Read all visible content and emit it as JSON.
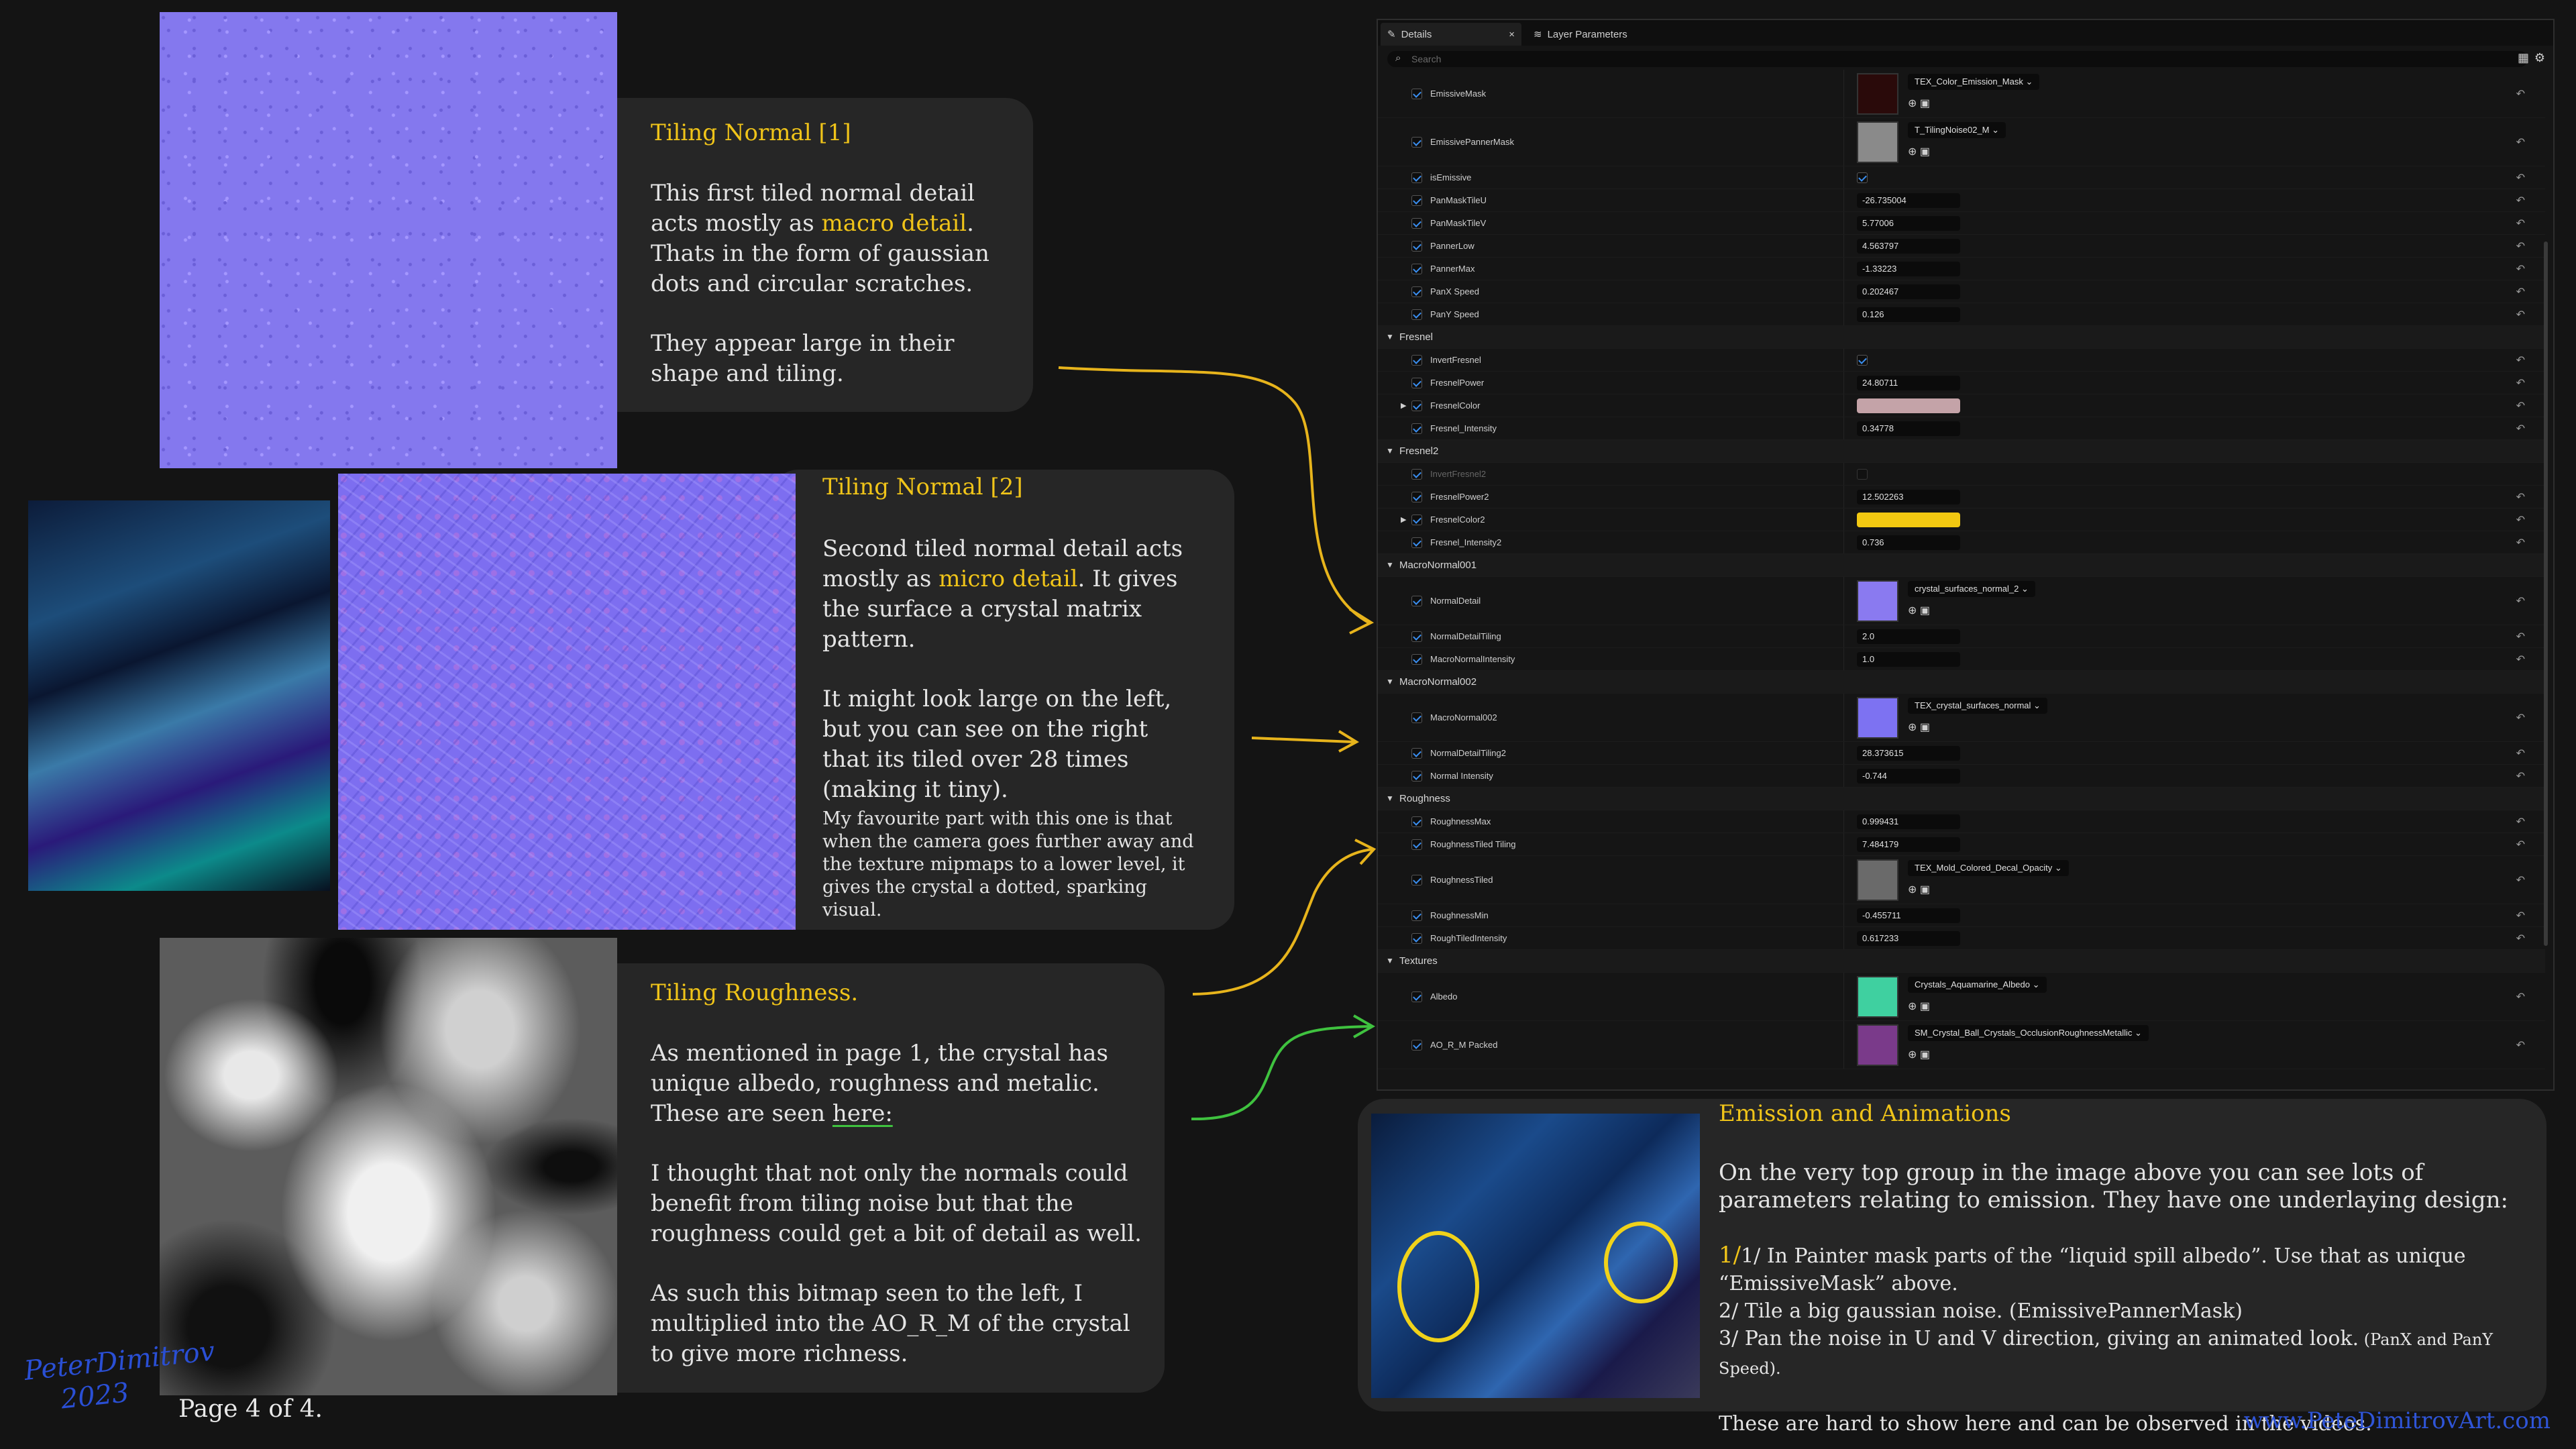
{
  "left_cards": {
    "normal1": {
      "title": "Tiling Normal [1]",
      "p1_a": "This first tiled normal detail acts mostly as ",
      "p1_hl": "macro detail",
      "p1_b": ". Thats in the form of gaussian dots and circular scratches.",
      "p2": "They appear large in their shape and tiling."
    },
    "normal2": {
      "title": "Tiling Normal [2]",
      "p1_a": "Second tiled normal detail acts mostly as ",
      "p1_hl": "micro detail",
      "p1_b": ". It gives the surface a crystal matrix pattern.",
      "p2": "It might look large on the left, but you can see on the right that its tiled over 28 times (making it tiny).",
      "p3": "My favourite part with this one is that when the camera goes further away and the texture mipmaps to a lower level, it gives the crystal a dotted, sparking visual."
    },
    "roughness": {
      "title": "Tiling Roughness.",
      "p1_a": "As mentioned in page 1, the crystal has unique albedo, roughness and metalic. These are seen ",
      "p1_link": "here:",
      "p2": "I thought that not only the normals could benefit from tiling noise but that the roughness could get a bit of detail as well.",
      "p3": "As such this bitmap seen to the left, I multiplied into the AO_R_M of the crystal to give more richness."
    }
  },
  "emission_card": {
    "title": "Emission and Animations",
    "intro": "On the very top group in the image above you can see lots of parameters relating to emission. They have one underlaying design:",
    "step1": "1/ In Painter mask parts of the “liquid spill albedo”. Use that as unique “EmissiveMask” above.",
    "step2": "2/ Tile a big gaussian noise. (EmissivePannerMask)",
    "step3_a": "3/ Pan the noise in U and V direction, giving an animated look.",
    "step3_b": " (PanX and PanY Speed).",
    "outro": "These are hard to show here and can be observed in the videos."
  },
  "footer": {
    "page": "Page 4 of 4.",
    "website": "www.PeteDimitrovArt.com",
    "signature_line1": "PeterDimitrov",
    "signature_line2": "2023"
  },
  "panel": {
    "tabs": [
      {
        "label": "Details",
        "close": "×"
      },
      {
        "label": "Layer Parameters"
      }
    ],
    "search_placeholder": "Search",
    "reset_glyph": "↶",
    "asset_icons": "⊕ ▣",
    "colors": {
      "fresnel_color": "#c4a3a8",
      "fresnel_color2": "#f2c811"
    },
    "rows": [
      {
        "kind": "tex",
        "label": "EmissiveMask",
        "asset": "TEX_Color_Emission_Mask",
        "thumb": "#2a0a0a"
      },
      {
        "kind": "tex",
        "label": "EmissivePannerMask",
        "asset": "T_TilingNoise02_M",
        "thumb": "#8a8a8a"
      },
      {
        "kind": "bool",
        "label": "isEmissive",
        "on": true
      },
      {
        "kind": "num",
        "label": "PanMaskTileU",
        "value": "-26.735004"
      },
      {
        "kind": "num",
        "label": "PanMaskTileV",
        "value": "5.77006"
      },
      {
        "kind": "num",
        "label": "PannerLow",
        "value": "4.563797"
      },
      {
        "kind": "num",
        "label": "PannerMax",
        "value": "-1.33223"
      },
      {
        "kind": "num",
        "label": "PanX Speed",
        "value": "0.202467"
      },
      {
        "kind": "num",
        "label": "PanY Speed",
        "value": "0.126"
      },
      {
        "kind": "group",
        "label": "Fresnel"
      },
      {
        "kind": "bool",
        "label": "InvertFresnel",
        "on": true
      },
      {
        "kind": "num",
        "label": "FresnelPower",
        "value": "24.80711"
      },
      {
        "kind": "color",
        "label": "FresnelColor",
        "color": "fresnel_color"
      },
      {
        "kind": "num",
        "label": "Fresnel_Intensity",
        "value": "0.34778"
      },
      {
        "kind": "group",
        "label": "Fresnel2"
      },
      {
        "kind": "bool",
        "label": "InvertFresnel2",
        "on": false,
        "disabled": true
      },
      {
        "kind": "num",
        "label": "FresnelPower2",
        "value": "12.502263"
      },
      {
        "kind": "color",
        "label": "FresnelColor2",
        "color": "fresnel_color2"
      },
      {
        "kind": "num",
        "label": "Fresnel_Intensity2",
        "value": "0.736"
      },
      {
        "kind": "group",
        "label": "MacroNormal001"
      },
      {
        "kind": "tex",
        "label": "NormalDetail",
        "asset": "crystal_surfaces_normal_2",
        "thumb": "#8a7af0"
      },
      {
        "kind": "num",
        "label": "NormalDetailTiling",
        "value": "2.0"
      },
      {
        "kind": "num",
        "label": "MacroNormalIntensity",
        "value": "1.0"
      },
      {
        "kind": "group",
        "label": "MacroNormal002"
      },
      {
        "kind": "tex",
        "label": "MacroNormal002",
        "asset": "TEX_crystal_surfaces_normal",
        "thumb": "#7d72f2"
      },
      {
        "kind": "num",
        "label": "NormalDetailTiling2",
        "value": "28.373615"
      },
      {
        "kind": "num",
        "label": "Normal Intensity",
        "value": "-0.744"
      },
      {
        "kind": "group",
        "label": "Roughness"
      },
      {
        "kind": "num",
        "label": "RoughnessMax",
        "value": "0.999431"
      },
      {
        "kind": "num",
        "label": "RoughnessTiled Tiling",
        "value": "7.484179"
      },
      {
        "kind": "tex",
        "label": "RoughnessTiled",
        "asset": "TEX_Mold_Colored_Decal_Opacity",
        "thumb": "#6a6a6a"
      },
      {
        "kind": "num",
        "label": "RoughnessMin",
        "value": "-0.455711"
      },
      {
        "kind": "num",
        "label": "RoughTiledIntensity",
        "value": "0.617233"
      },
      {
        "kind": "group",
        "label": "Textures"
      },
      {
        "kind": "tex",
        "label": "Albedo",
        "asset": "Crystals_Aquamarine_Albedo",
        "thumb": "#3fd0a0"
      },
      {
        "kind": "tex",
        "label": "AO_R_M Packed",
        "asset": "SM_Crystal_Ball_Crystals_OcclusionRoughnessMetallic",
        "thumb": "#7a3a8a"
      }
    ]
  }
}
